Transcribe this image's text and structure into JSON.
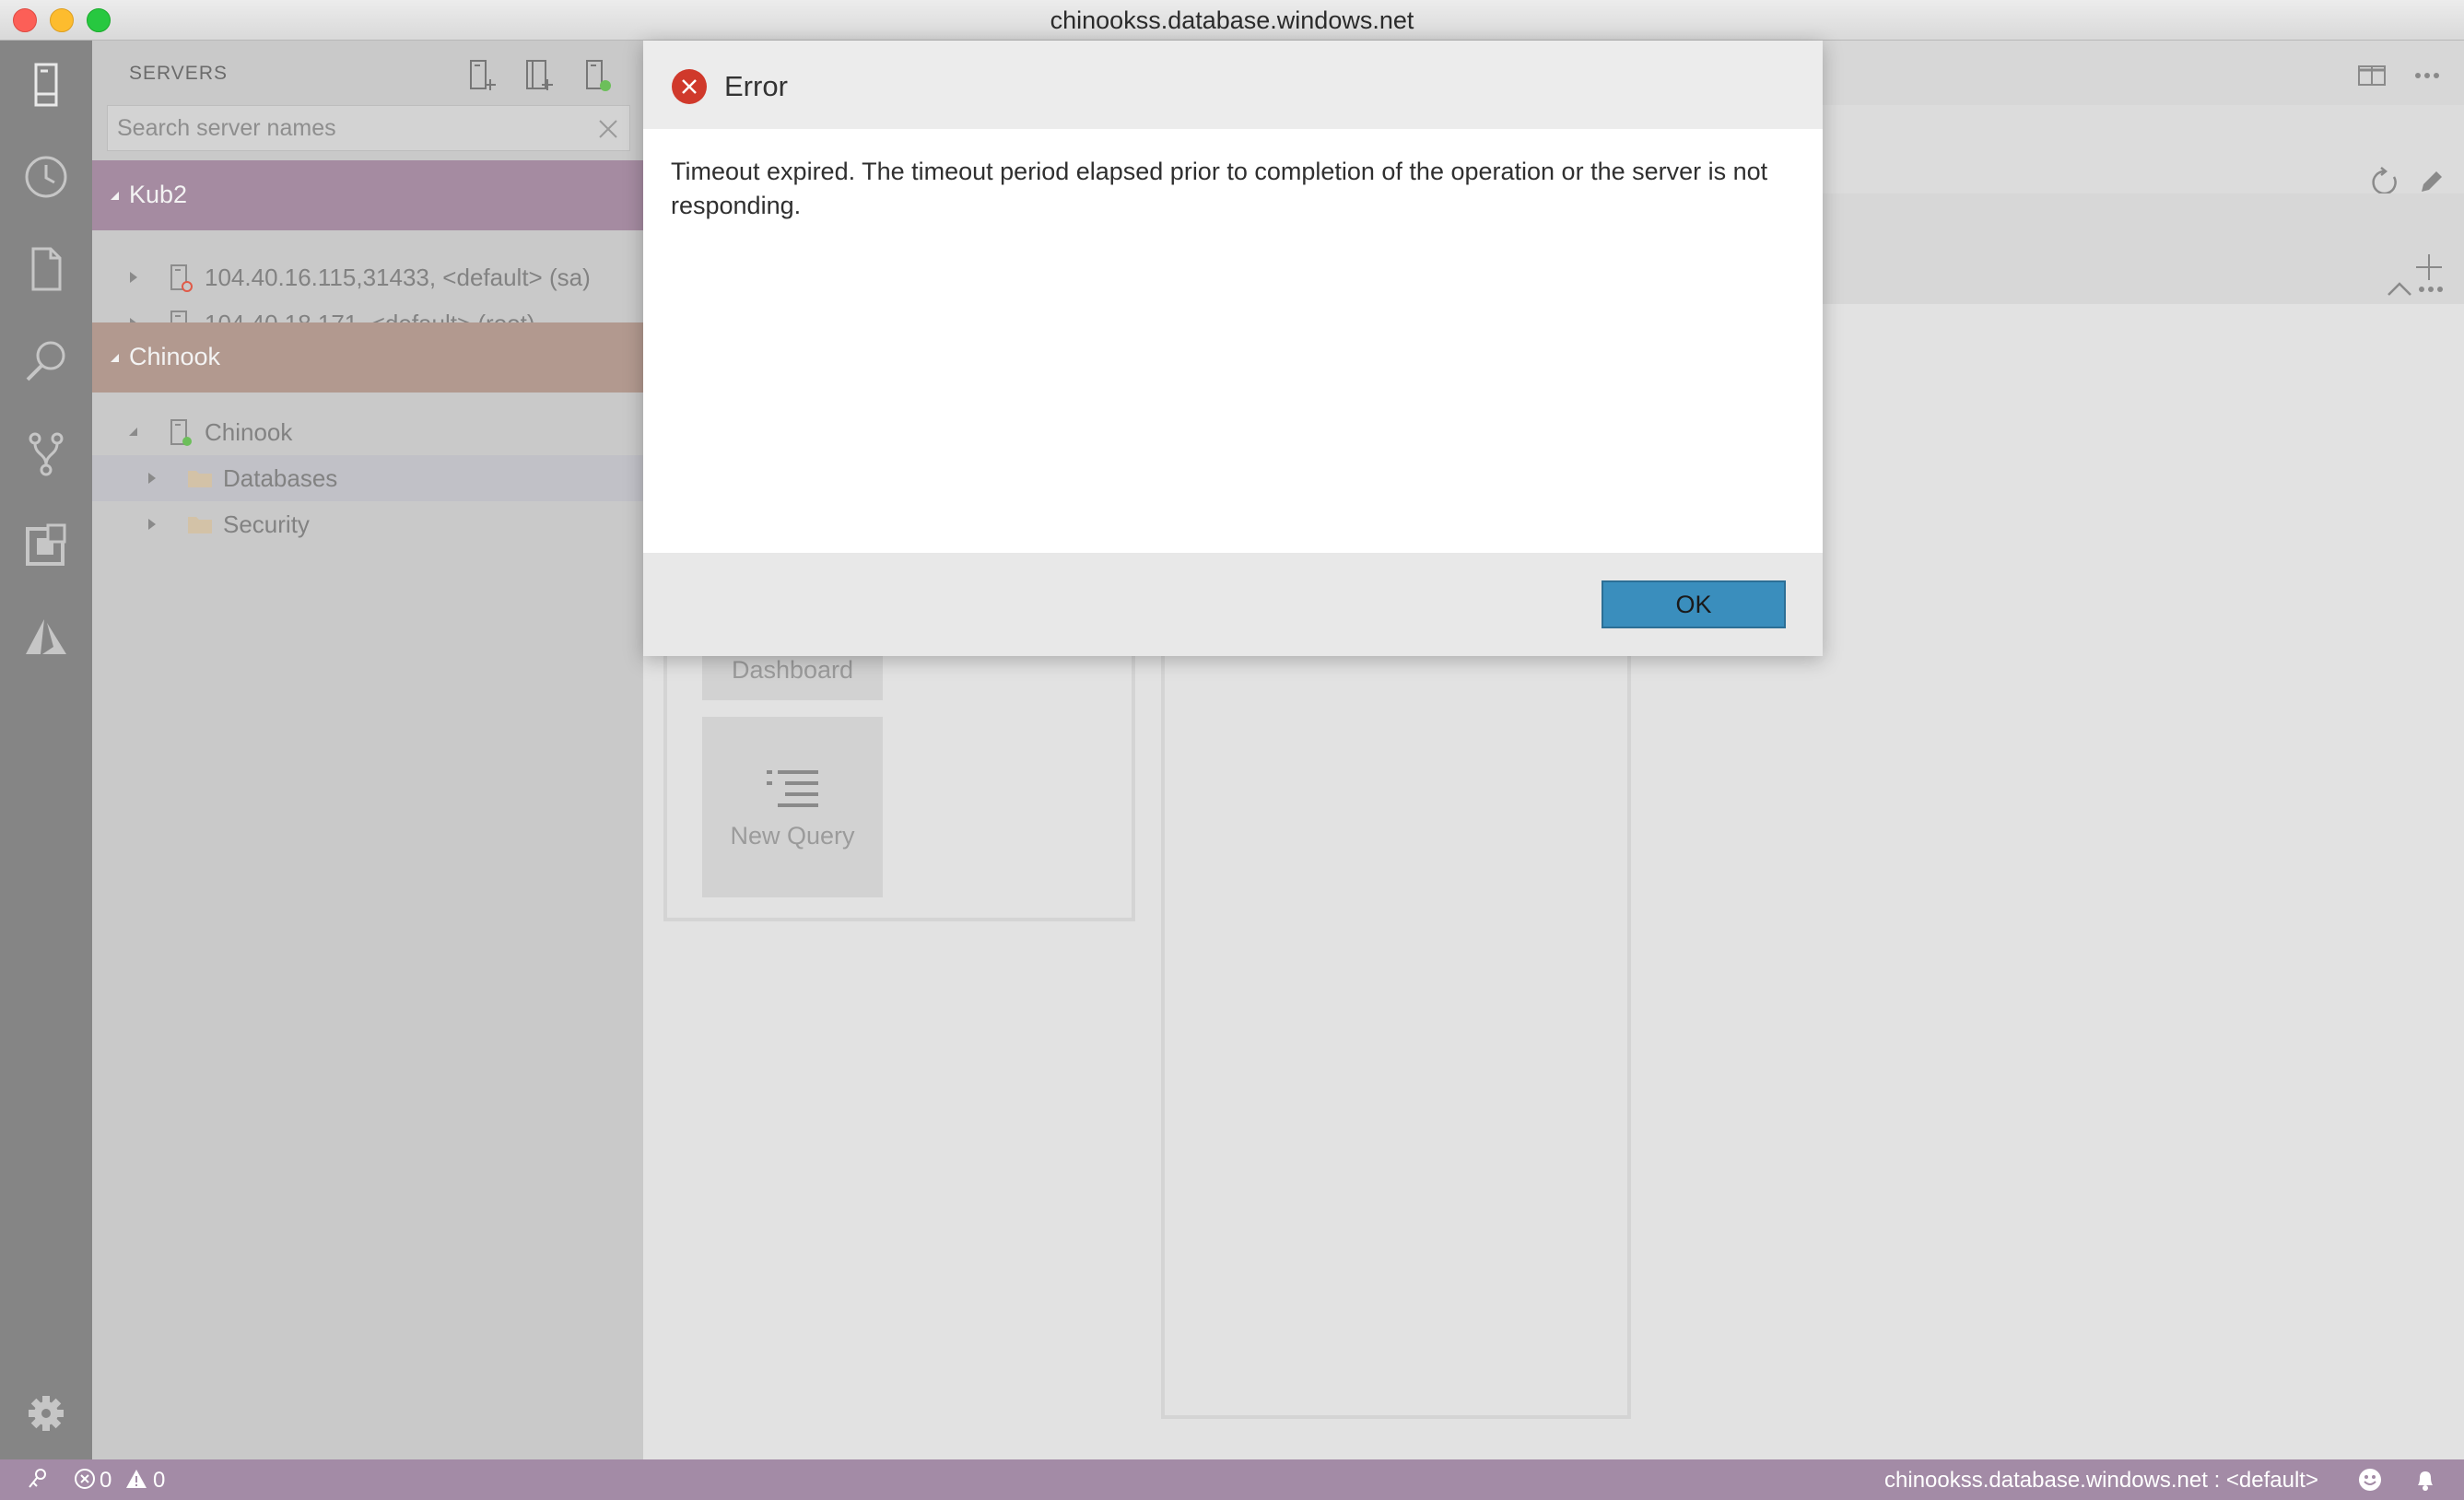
{
  "window": {
    "title": "chinookss.database.windows.net"
  },
  "activity_bar": {
    "items": [
      "servers-icon",
      "history-icon",
      "file-icon",
      "search-icon",
      "source-control-icon",
      "extensions-icon",
      "azure-icon",
      "settings-icon"
    ]
  },
  "sidebar": {
    "header": "SERVERS",
    "search": {
      "placeholder": "Search server names",
      "value": ""
    },
    "groups": [
      {
        "label": "Kub2",
        "color": "#a58ba1",
        "servers": [
          {
            "label": "104.40.16.115,31433, <default> (sa)",
            "status": "disconnected"
          },
          {
            "label": "104.40.18.171, <default> (root)",
            "status": "disconnected"
          }
        ]
      },
      {
        "label": "Chinook",
        "color": "#b2998f",
        "servers": [
          {
            "label": "Chinook",
            "status": "connected",
            "children": [
              "Databases",
              "Security"
            ]
          }
        ]
      }
    ]
  },
  "editor": {
    "tasks": {
      "dashboard_label": "Dashboard",
      "new_query_label": "New Query"
    }
  },
  "dialog": {
    "title": "Error",
    "message": "Timeout expired.  The timeout period elapsed prior to completion of the operation or the server is not responding.",
    "ok_label": "OK"
  },
  "status_bar": {
    "errors": "0",
    "warnings": "0",
    "connection": "chinookss.database.windows.net : <default>",
    "color": "#a38ba6"
  }
}
